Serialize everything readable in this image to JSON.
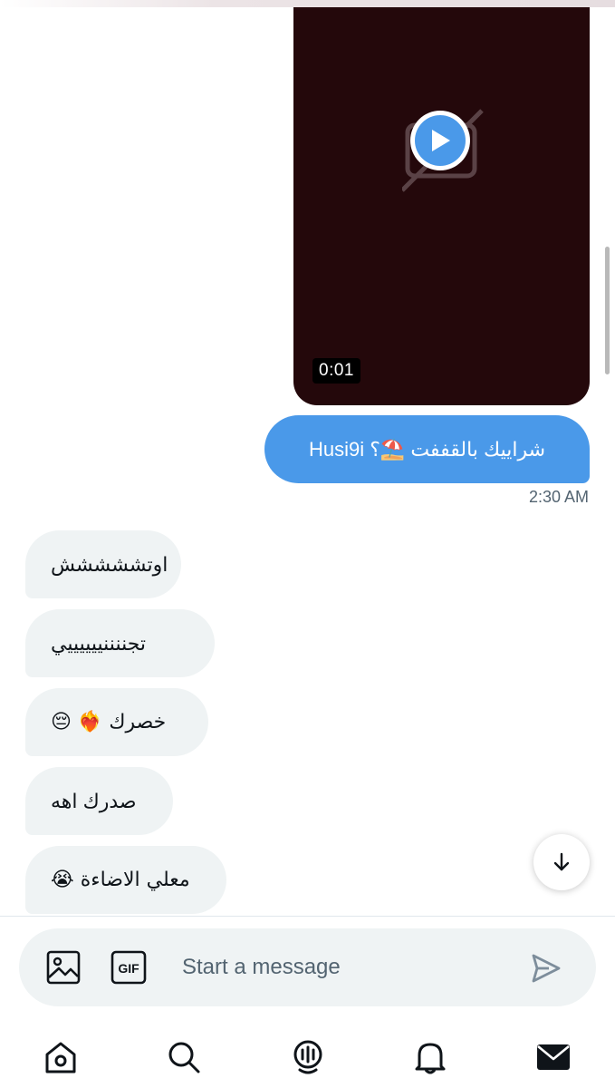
{
  "video": {
    "duration": "0:01"
  },
  "messages": {
    "outgoing": [
      {
        "text": "شراييك بالقففت ⛱️؟ Husi9i",
        "time": "2:30 AM"
      }
    ],
    "incoming": [
      {
        "text": "اوتششششش"
      },
      {
        "text": "تجننننييييييي"
      },
      {
        "text": "خصرك ❤️‍🔥 😔"
      },
      {
        "text": "صدرك اهه"
      },
      {
        "text": "معلي الاضاءة 😭"
      }
    ]
  },
  "composer": {
    "placeholder": "Start a message",
    "gif_label": "GIF"
  },
  "colors": {
    "accent": "#4a99e9",
    "bubble_in": "#eff3f4",
    "video_bg": "#24080b"
  },
  "nav": {
    "icons": [
      "home-icon",
      "search-icon",
      "spaces-icon",
      "notifications-icon",
      "messages-icon"
    ]
  }
}
